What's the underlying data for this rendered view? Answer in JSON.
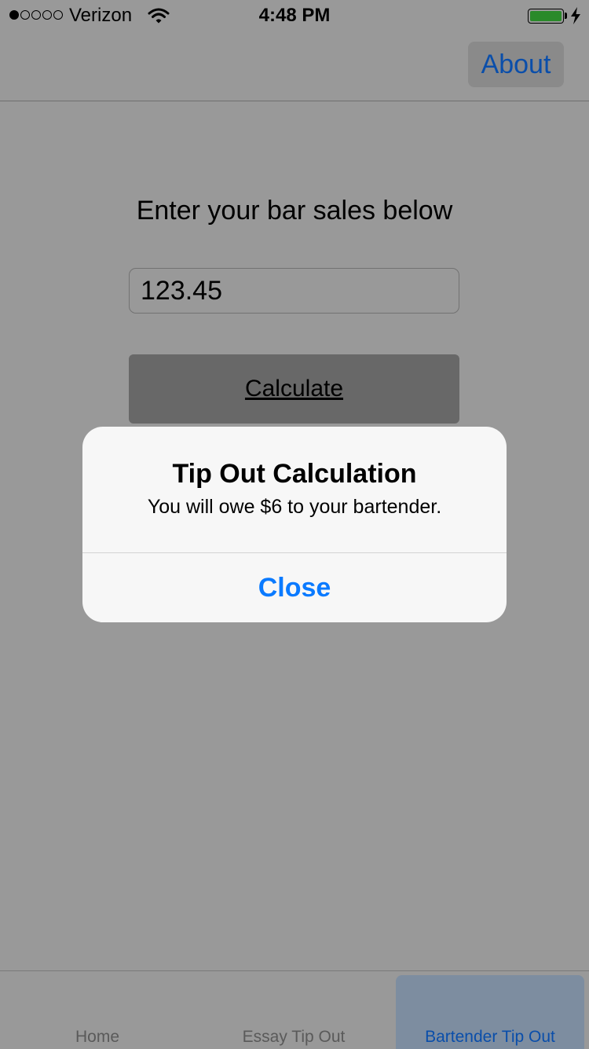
{
  "status_bar": {
    "carrier": "Verizon",
    "time": "4:48 PM",
    "signal_bars_filled": 1,
    "signal_bars_total": 5,
    "battery_level": 1.0,
    "battery_color": "#2a8a2a"
  },
  "nav": {
    "about_label": "About"
  },
  "main": {
    "prompt": "Enter your bar sales below",
    "sales_value": "123.45",
    "calculate_label": "Calculate"
  },
  "alert": {
    "title": "Tip Out Calculation",
    "message": "You will owe $6 to your bartender.",
    "close_label": "Close"
  },
  "tabs": [
    {
      "label": "Home",
      "selected": false
    },
    {
      "label": "Essay Tip Out",
      "selected": false
    },
    {
      "label": "Bartender Tip Out",
      "selected": true
    }
  ],
  "colors": {
    "accent": "#0a7aff",
    "dimmed_accent": "#0a4eaa",
    "overlay_background": "#999999"
  }
}
